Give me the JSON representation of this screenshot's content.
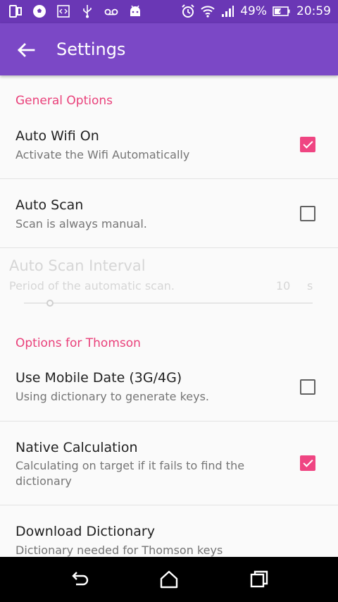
{
  "status_bar": {
    "battery_percent": "49%",
    "time": "20:59",
    "left_icons": [
      "phone-icon",
      "soccer-ball-icon",
      "code-icon",
      "usb-icon",
      "voicemail-icon",
      "android-icon"
    ],
    "right_icons": [
      "alarm-icon",
      "wifi-icon",
      "signal-icon",
      "battery-icon"
    ]
  },
  "app_bar": {
    "title": "Settings",
    "back_icon": "arrow-left-icon"
  },
  "colors": {
    "status_bar": "#6a37b5",
    "app_bar": "#7b48c6",
    "accent": "#ef4582",
    "section_title": "#e9407a"
  },
  "sections": [
    {
      "title": "General Options",
      "items": [
        {
          "title": "Auto Wifi On",
          "summary": "Activate the Wifi Automatically",
          "checked": true
        },
        {
          "title": "Auto Scan",
          "summary": "Scan is always manual.",
          "checked": false
        },
        {
          "title": "Auto Scan Interval",
          "summary": "Period of the automatic scan.",
          "value": "10",
          "unit": "s",
          "enabled": false,
          "slider_fraction": 0.09
        }
      ]
    },
    {
      "title": "Options for Thomson",
      "items": [
        {
          "title": "Use Mobile Date (3G/4G)",
          "summary": "Using dictionary to generate keys.",
          "checked": false
        },
        {
          "title": "Native Calculation",
          "summary": "Calculating on target if it fails to find the dictionary",
          "checked": true
        },
        {
          "title": "Download Dictionary",
          "summary": "Dictionary needed for Thomson keys"
        }
      ]
    }
  ],
  "nav_bar": {
    "icons": [
      "back-nav-icon",
      "home-nav-icon",
      "recents-nav-icon"
    ]
  }
}
